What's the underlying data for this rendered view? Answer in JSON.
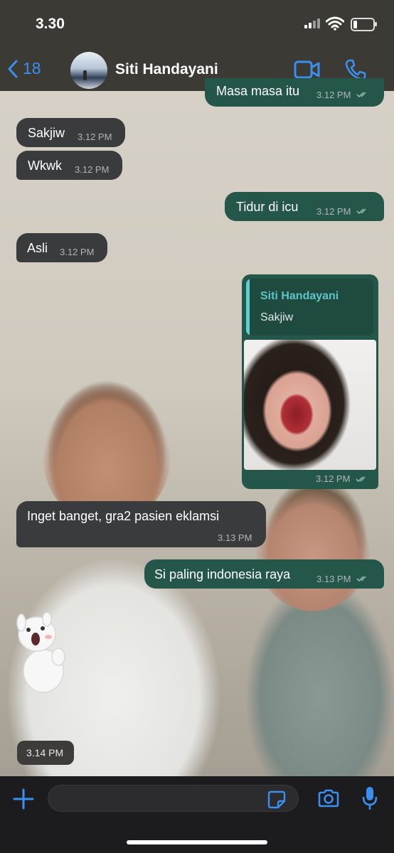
{
  "status_bar": {
    "time": "3.30"
  },
  "header": {
    "back_count": "18",
    "contact_name": "Siti Handayani",
    "icons": [
      "back-chevron-icon",
      "video-call-icon",
      "phone-call-icon"
    ]
  },
  "messages": [
    {
      "direction": "outgoing",
      "text": "Masa masa itu",
      "time": "3.12 PM",
      "read": true
    },
    {
      "direction": "incoming",
      "text": "Sakjiw",
      "time": "3.12 PM"
    },
    {
      "direction": "incoming",
      "text": "Wkwk",
      "time": "3.12 PM"
    },
    {
      "direction": "outgoing",
      "text": "Tidur di icu",
      "time": "3.12 PM",
      "read": true
    },
    {
      "direction": "incoming",
      "text": "Asli",
      "time": "3.12 PM"
    },
    {
      "direction": "outgoing",
      "type": "image",
      "reply_to": {
        "name": "Siti Handayani",
        "text": "Sakjiw"
      },
      "time": "3.12 PM",
      "read": true
    },
    {
      "direction": "incoming",
      "text": "Inget banget, gra2 pasien eklamsi",
      "time": "3.13 PM"
    },
    {
      "direction": "outgoing",
      "text": "Si paling indonesia raya",
      "time": "3.13 PM",
      "read": true
    },
    {
      "direction": "incoming",
      "type": "sticker",
      "time": "3.14 PM"
    }
  ],
  "composer": {
    "icons": [
      "plus-icon",
      "sticker-icon",
      "camera-icon",
      "microphone-icon"
    ]
  },
  "colors": {
    "outgoing_bubble": "#24574a",
    "incoming_bubble": "#3a3b3d",
    "accent": "#3a8ff0",
    "reply_accent": "#5fc4c8"
  }
}
